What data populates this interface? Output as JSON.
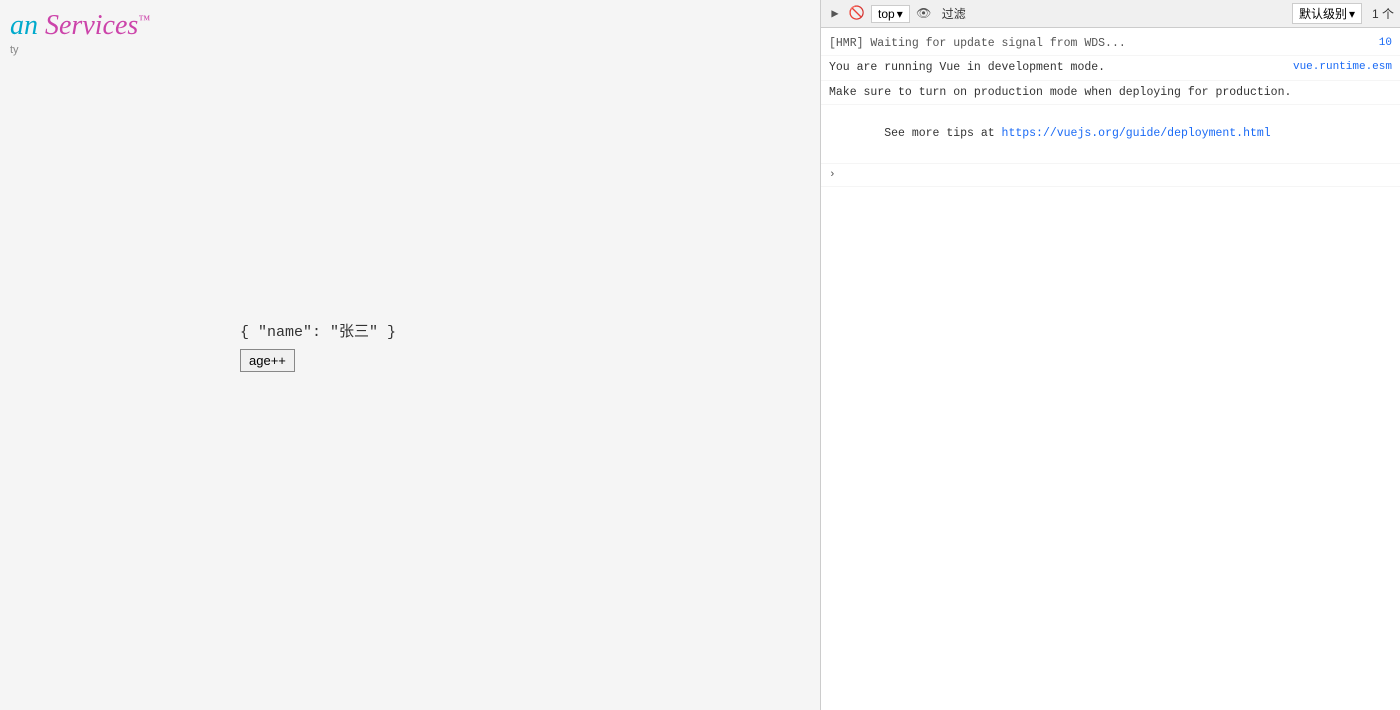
{
  "app": {
    "logo": {
      "an": "an",
      "services": " Services",
      "trademark": "™",
      "subtitle": "ty"
    },
    "data_display": "{ \"name\": \"张三\" }",
    "age_button_label": "age++"
  },
  "devtools": {
    "toolbar": {
      "top_label": "top",
      "filter_label": "过滤",
      "level_label": "默认级别",
      "count_label": "1 个"
    },
    "console_lines": [
      {
        "id": "hmr-line",
        "type": "hmr",
        "text": "[HMR] Waiting for update signal from WDS...",
        "source": "10"
      },
      {
        "id": "vue-dev-line1",
        "type": "info",
        "text": "You are running Vue in development mode.",
        "source": "vue.runtime.esm"
      },
      {
        "id": "vue-dev-line2",
        "type": "info",
        "text": "Make sure to turn on production mode when deploying for production.",
        "source": ""
      },
      {
        "id": "vue-dev-line3",
        "type": "info",
        "text": "See more tips at ",
        "link_text": "https://vuejs.org/guide/deployment.html",
        "link_url": "https://vuejs.org/guide/deployment.html",
        "source": ""
      }
    ],
    "icons": {
      "play": "▶",
      "block": "🚫",
      "eye": "👁",
      "chevron_down": "▾",
      "collapse_arrow": "›"
    }
  }
}
